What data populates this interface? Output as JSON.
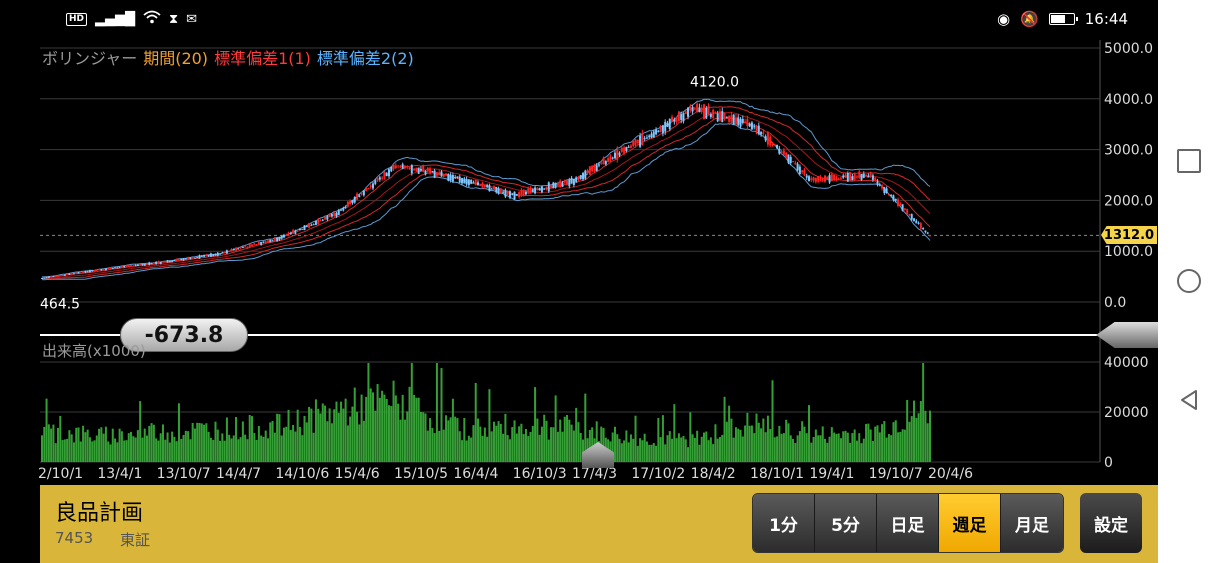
{
  "status_bar": {
    "hd_label": "HD",
    "time": "16:44",
    "battery_level": 0.6,
    "icons": [
      "hd-icon",
      "signal-icon",
      "wifi-icon",
      "hourglass-icon",
      "mail-icon",
      "eye-icon",
      "bell-off-icon",
      "battery-icon"
    ]
  },
  "legend": {
    "name": "ボリンジャー",
    "period": "期間(20)",
    "sd1": "標準偏差1(1)",
    "sd2": "標準偏差2(2)"
  },
  "price_axis_labels": [
    "5000.0",
    "4000.0",
    "3000.0",
    "2000.0",
    "1000.0",
    "0.0"
  ],
  "volume_axis_labels": [
    "40000",
    "20000",
    "0"
  ],
  "x_axis_labels": [
    "2/10/1",
    "13/4/1",
    "13/10/7",
    "14/4/7",
    "14/10/6",
    "15/4/6",
    "15/10/5",
    "16/4/4",
    "16/10/3",
    "17/4/3",
    "17/10/2",
    "18/4/2",
    "18/10/1",
    "19/4/1",
    "19/10/7",
    "20/4/6"
  ],
  "annotations": {
    "max_label": "4120.0",
    "min_label": "464.5",
    "current_price": "1312.0",
    "cursor_value": "-673.8"
  },
  "volume_label": "出来高(x1000)",
  "colors": {
    "up_candle": "#ff2020",
    "down_candle": "#7ec8ff",
    "volume_bar": "#35a035",
    "ma_line": "#a01818",
    "band1": "#d02828",
    "band2": "#5a9ad0",
    "accent": "#d9b53a",
    "active_period": "#f0a800"
  },
  "chart_data": {
    "type": "line",
    "title": "",
    "xlabel": "",
    "ylabel": "",
    "ylim": [
      0,
      5000
    ],
    "volume_ylim": [
      0,
      40000
    ],
    "x": [
      "2/10/1",
      "13/4/1",
      "13/10/7",
      "14/4/7",
      "14/10/6",
      "15/4/6",
      "15/10/5",
      "16/4/4",
      "16/10/3",
      "17/4/3",
      "17/10/2",
      "18/4/2",
      "18/10/1",
      "19/4/1",
      "19/10/7",
      "20/4/6"
    ],
    "series": [
      {
        "name": "",
        "values": [
          470,
          640,
          780,
          950,
          1250,
          1750,
          2700,
          2450,
          2100,
          2400,
          3100,
          3800,
          3500,
          2400,
          2500,
          1312
        ]
      }
    ],
    "volume_values": [
      13000,
      11000,
      12500,
      14000,
      15000,
      22000,
      26000,
      14000,
      15000,
      14500,
      10000,
      9500,
      16000,
      11000,
      12500,
      22000
    ],
    "max_marker": 4120.0,
    "min_marker": 464.5,
    "last_price": 1312.0,
    "grid": true
  },
  "stock": {
    "name": "良品計画",
    "code": "7453",
    "market": "東証"
  },
  "period_buttons": [
    {
      "label": "1分",
      "active": false
    },
    {
      "label": "5分",
      "active": false
    },
    {
      "label": "日足",
      "active": false
    },
    {
      "label": "週足",
      "active": true
    },
    {
      "label": "月足",
      "active": false
    }
  ],
  "settings_label": "設定"
}
